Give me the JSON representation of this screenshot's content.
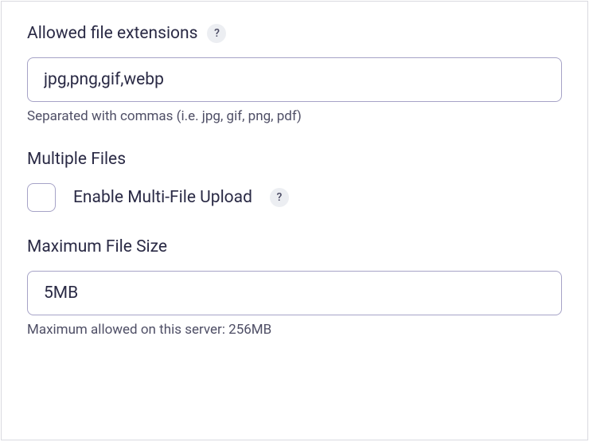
{
  "extensions": {
    "label": "Allowed file extensions",
    "value": "jpg,png,gif,webp",
    "helper": "Separated with commas (i.e. jpg, gif, png, pdf)"
  },
  "multiple": {
    "label": "Multiple Files",
    "checkbox_label": "Enable Multi-File Upload",
    "checked": false
  },
  "maxsize": {
    "label": "Maximum File Size",
    "value": "5MB",
    "helper": "Maximum allowed on this server: 256MB"
  },
  "help_glyph": "?"
}
